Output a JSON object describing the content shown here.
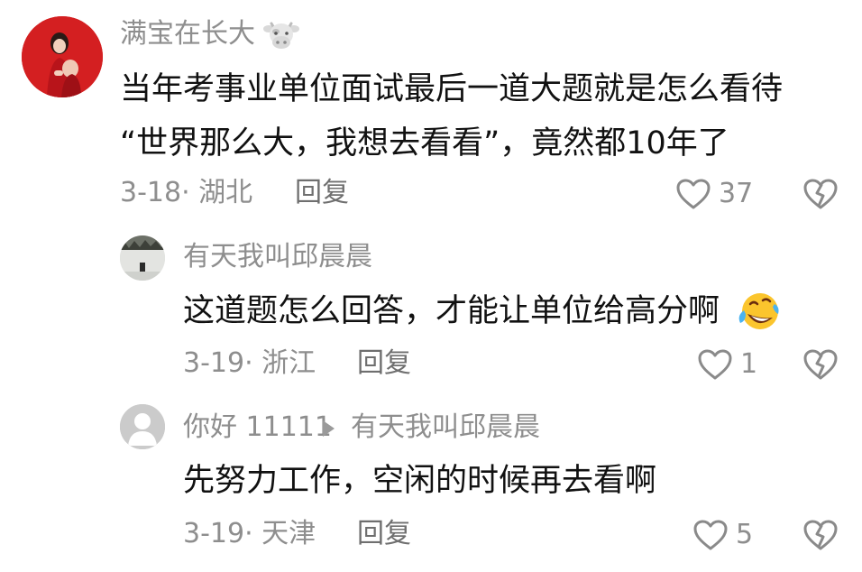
{
  "comments": [
    {
      "username": "满宝在长大",
      "username_badge_icon": "cow-face-icon",
      "text_lines": [
        "当年考事业单位面试最后一道大题就是怎么看待",
        "“世界那么大，我想去看看”，竟然都10年了"
      ],
      "meta": "3-18· 湖北",
      "reply_label": "回复",
      "like_count": "37"
    },
    {
      "username": "有天我叫邱晨晨",
      "text": "这道题怎么回答，才能让单位给高分啊",
      "emoji": "laughing-crying-emoji",
      "meta": "3-19· 浙江",
      "reply_label": "回复",
      "like_count": "1"
    },
    {
      "username": "你好 11111",
      "reply_to": "有天我叫邱晨晨",
      "text": "先努力工作，空闲的时候再去看啊",
      "meta": "3-19· 天津",
      "reply_label": "回复",
      "like_count": "5"
    }
  ],
  "colors": {
    "secondary_text": "#8e8e8e",
    "body_text": "#111111",
    "avatar_red": "#d41f21",
    "icon_gray": "#8a8a8a"
  }
}
